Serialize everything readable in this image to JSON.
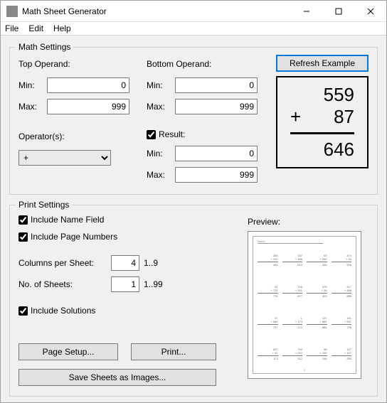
{
  "window": {
    "title": "Math Sheet Generator"
  },
  "menubar": {
    "file": "File",
    "edit": "Edit",
    "help": "Help"
  },
  "math_settings": {
    "group_title": "Math Settings",
    "top_operand_label": "Top Operand:",
    "bottom_operand_label": "Bottom Operand:",
    "min_label": "Min:",
    "max_label": "Max:",
    "top_min": "0",
    "top_max": "999",
    "bottom_min": "0",
    "bottom_max": "999",
    "operators_label": "Operator(s):",
    "operator_selected": "+",
    "result_label": "Result:",
    "result_checked": true,
    "result_min": "0",
    "result_max": "999",
    "refresh_button": "Refresh Example",
    "example": {
      "top": "559",
      "operator": "+",
      "bottom": "87",
      "result": "646"
    }
  },
  "print_settings": {
    "group_title": "Print Settings",
    "include_name_label": "Include Name Field",
    "include_name_checked": true,
    "include_page_label": "Include Page Numbers",
    "include_page_checked": true,
    "columns_label": "Columns per Sheet:",
    "columns_value": "4",
    "columns_hint": "1..9",
    "sheets_label": "No. of Sheets:",
    "sheets_value": "1",
    "sheets_hint": "1..99",
    "include_solutions_label": "Include Solutions",
    "include_solutions_checked": true,
    "page_setup_button": "Page Setup...",
    "print_button": "Print...",
    "save_images_button": "Save Sheets as Images...",
    "preview_label": "Preview:"
  }
}
